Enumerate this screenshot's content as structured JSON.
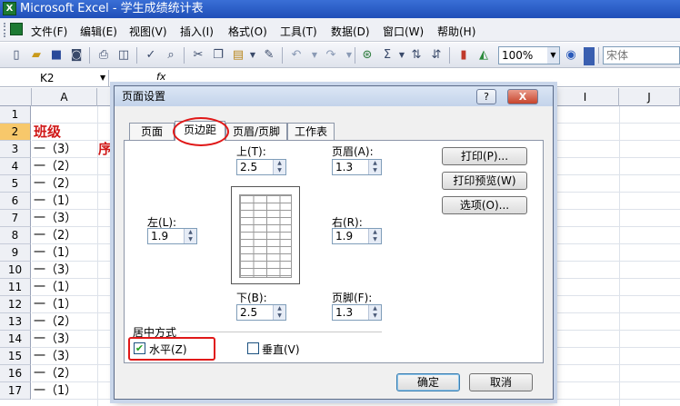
{
  "window": {
    "title": "Microsoft Excel - 学生成绩统计表",
    "app_icon": "excel-icon"
  },
  "menu": {
    "items": [
      "文件(F)",
      "编辑(E)",
      "视图(V)",
      "插入(I)",
      "格式(O)",
      "工具(T)",
      "数据(D)",
      "窗口(W)",
      "帮助(H)"
    ]
  },
  "toolbar": {
    "zoom": "100%",
    "font": "宋体"
  },
  "formula_bar": {
    "cell_ref": "K2",
    "fx": "fx"
  },
  "sheet": {
    "columns": [
      "A",
      "I",
      "J"
    ],
    "rows": [
      "1",
      "2",
      "3",
      "4",
      "5",
      "6",
      "7",
      "8",
      "9",
      "10",
      "11",
      "12",
      "13",
      "14",
      "15",
      "16",
      "17"
    ],
    "col_a_values": [
      "",
      "班级",
      "一（3）",
      "一（2）",
      "一（2）",
      "一（1）",
      "一（3）",
      "一（2）",
      "一（1）",
      "一（3）",
      "一（1）",
      "一（1）",
      "一（2）",
      "一（3）",
      "一（3）",
      "一（2）",
      "一（1）"
    ],
    "row2_b_partial": "序",
    "header_color": "#d01818",
    "active_row_color": "#f7c86b"
  },
  "dialog": {
    "title": "页面设置",
    "help_label": "?",
    "close_label": "X",
    "tabs": [
      "页面",
      "页边距",
      "页眉/页脚",
      "工作表"
    ],
    "active_tab": "页边距",
    "margins": {
      "top_label": "上(T):",
      "top_value": "2.5",
      "header_label": "页眉(A):",
      "header_value": "1.3",
      "left_label": "左(L):",
      "left_value": "1.9",
      "right_label": "右(R):",
      "right_value": "1.9",
      "bottom_label": "下(B):",
      "bottom_value": "2.5",
      "footer_label": "页脚(F):",
      "footer_value": "1.3"
    },
    "side_buttons": [
      "打印(P)...",
      "打印预览(W)",
      "选项(O)..."
    ],
    "centering": {
      "label": "居中方式",
      "horizontal_label": "水平(Z)",
      "horizontal_checked": true,
      "vertical_label": "垂直(V)",
      "vertical_checked": false
    },
    "ok_label": "确定",
    "cancel_label": "取消"
  },
  "annotation_color": "#e01818"
}
